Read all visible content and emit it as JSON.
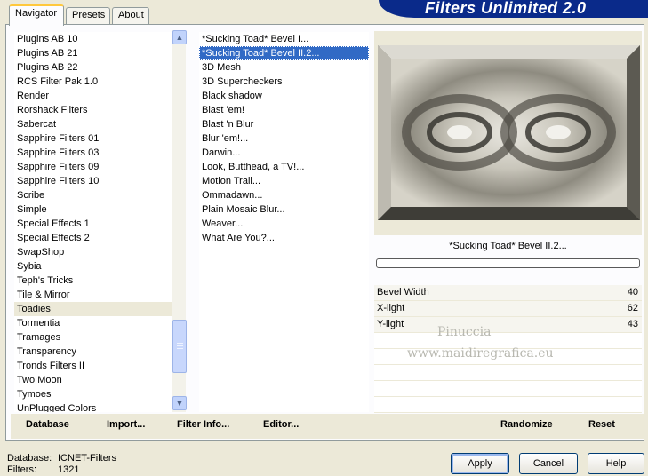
{
  "header": {
    "title": "Filters Unlimited 2.0"
  },
  "tabs": [
    {
      "label": "Navigator",
      "active": true
    },
    {
      "label": "Presets",
      "active": false
    },
    {
      "label": "About",
      "active": false
    }
  ],
  "categories": {
    "items": [
      "Plugins AB 10",
      "Plugins AB 21",
      "Plugins AB 22",
      "RCS Filter Pak 1.0",
      "Render",
      "Rorshack Filters",
      "Sabercat",
      "Sapphire Filters 01",
      "Sapphire Filters 03",
      "Sapphire Filters 09",
      "Sapphire Filters 10",
      "Scribe",
      "Simple",
      "Special Effects 1",
      "Special Effects 2",
      "SwapShop",
      "Sybia",
      "Teph's Tricks",
      "Tile & Mirror",
      "Toadies",
      "Tormentia",
      "Tramages",
      "Transparency",
      "Tronds Filters II",
      "Two Moon",
      "Tymoes",
      "UnPlugged Colors"
    ],
    "selected": "Toadies"
  },
  "filters": {
    "items": [
      "*Sucking Toad*  Bevel I...",
      "*Sucking Toad*  Bevel II.2...",
      "3D Mesh",
      "3D Supercheckers",
      "Black shadow",
      "Blast 'em!",
      "Blast 'n Blur",
      "Blur 'em!...",
      "Darwin...",
      "Look, Butthead, a TV!...",
      "Motion Trail...",
      "Ommadawn...",
      "Plain Mosaic Blur...",
      "Weaver...",
      "What Are You?..."
    ],
    "selected": "*Sucking Toad*  Bevel II.2..."
  },
  "preview": {
    "filter_name": "*Sucking Toad*  Bevel II.2...",
    "progress": 0
  },
  "parameters": [
    {
      "label": "Bevel Width",
      "value": "40"
    },
    {
      "label": "X-light",
      "value": "62"
    },
    {
      "label": "Y-light",
      "value": "43"
    }
  ],
  "watermark": {
    "line1": "Pinuccia",
    "line2": "www.maidiregrafica.eu"
  },
  "bar": {
    "database_label": "Database",
    "import_label": "Import...",
    "filter_info_label": "Filter Info...",
    "editor_label": "Editor...",
    "randomize_label": "Randomize",
    "reset_label": "Reset"
  },
  "status": {
    "database_key": "Database:",
    "database_value": "ICNET-Filters",
    "filters_key": "Filters:",
    "filters_value": "1321"
  },
  "dialog": {
    "apply_label": "Apply",
    "cancel_label": "Cancel",
    "help_label": "Help"
  },
  "colors": {
    "selection": "#316ac5",
    "banner": "#0a2a8a",
    "tab_highlight": "#ffc83c"
  },
  "icons": {
    "scroll_up": "chevron-up-icon",
    "scroll_down": "chevron-down-icon"
  }
}
